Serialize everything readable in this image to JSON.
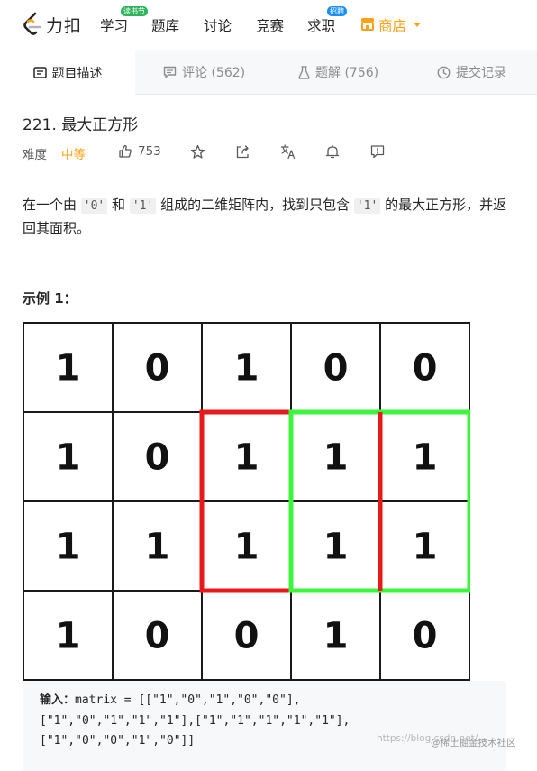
{
  "nav": {
    "brand": "力扣",
    "items": [
      {
        "label": "学习",
        "badge": "读书节"
      },
      {
        "label": "题库"
      },
      {
        "label": "讨论"
      },
      {
        "label": "竞赛"
      },
      {
        "label": "求职",
        "badge": "招聘"
      },
      {
        "label": "商店"
      }
    ],
    "accent_color": "#ffa116"
  },
  "tabs": [
    {
      "label": "题目描述",
      "active": true,
      "icon": "description-icon"
    },
    {
      "label": "评论 (562)",
      "icon": "comment-icon"
    },
    {
      "label": "题解 (756)",
      "icon": "flask-icon"
    },
    {
      "label": "提交记录",
      "icon": "clock-icon"
    }
  ],
  "problem": {
    "title": "221. 最大正方形",
    "difficulty_label": "难度",
    "difficulty": "中等",
    "likes": "753",
    "desc_part1": "在一个由 ",
    "code1": "'0'",
    "desc_part2": " 和 ",
    "code2": "'1'",
    "desc_part3": " 组成的二维矩阵内，找到只包含 ",
    "code3": "'1'",
    "desc_part4": " 的最大正方形，并返回其面积。",
    "example_title": "示例 1：",
    "matrix": [
      [
        "1",
        "0",
        "1",
        "0",
        "0"
      ],
      [
        "1",
        "0",
        "1",
        "1",
        "1"
      ],
      [
        "1",
        "1",
        "1",
        "1",
        "1"
      ],
      [
        "1",
        "0",
        "0",
        "1",
        "0"
      ]
    ],
    "highlight_colors": {
      "red": "#e8191b",
      "green": "#3cf53c"
    }
  },
  "code_example": {
    "input_label": "输入：",
    "line1": "matrix = [[\"1\",\"0\",\"1\",\"0\",\"0\"],",
    "line2": "[\"1\",\"0\",\"1\",\"1\",\"1\"],[\"1\",\"1\",\"1\",\"1\",\"1\"],",
    "line3": "[\"1\",\"0\",\"0\",\"1\",\"0\"]]"
  },
  "watermark": {
    "url": "https://blog.csdn.net/...",
    "brand": "@稀土掘金技术社区"
  }
}
